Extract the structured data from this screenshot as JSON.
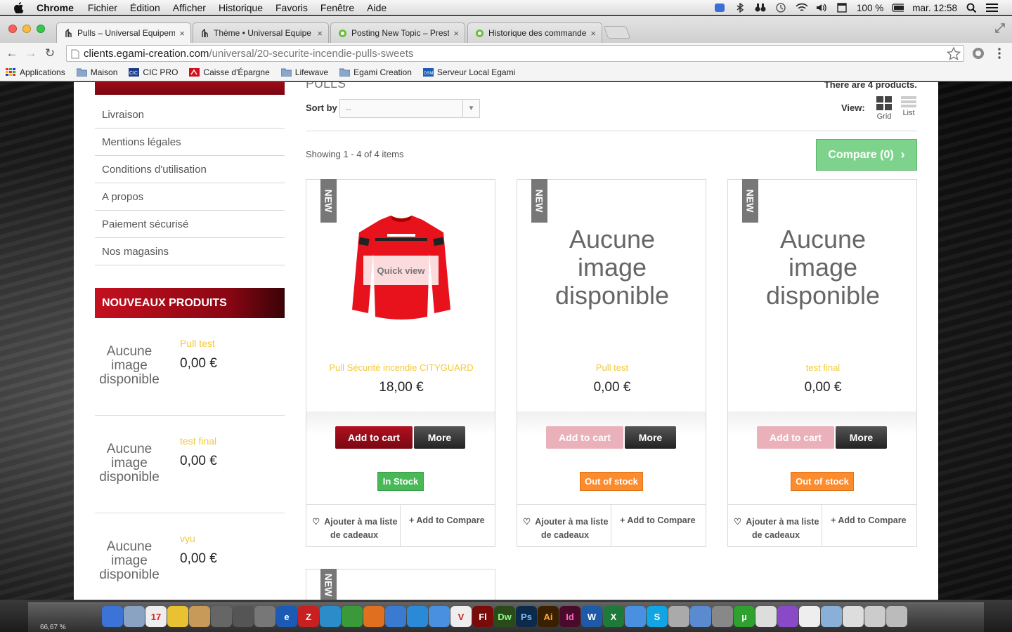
{
  "menubar": {
    "app_name": "Chrome",
    "items": [
      "Fichier",
      "Édition",
      "Afficher",
      "Historique",
      "Favoris",
      "Fenêtre",
      "Aide"
    ],
    "battery": "100 %",
    "clock": "mar. 12:58"
  },
  "tabs": [
    {
      "title": "Pulls – Universal Equipeme",
      "active": true
    },
    {
      "title": "Thème • Universal Equipe",
      "active": false
    },
    {
      "title": "Posting New Topic – Presta",
      "active": false
    },
    {
      "title": "Historique des commande",
      "active": false
    }
  ],
  "omnibox": {
    "host": "clients.egami-creation.com",
    "path": "/universal/20-securite-incendie-pulls-sweets"
  },
  "bookmarks": [
    "Applications",
    "Maison",
    "CIC PRO",
    "Caisse d'Épargne",
    "Lifewave",
    "Egami Creation",
    "Serveur Local Egami"
  ],
  "sidebar": {
    "info_links": [
      "Livraison",
      "Mentions légales",
      "Conditions d'utilisation",
      "A propos",
      "Paiement sécurisé",
      "Nos magasins"
    ],
    "new_products_title": "NOUVEAUX PRODUITS",
    "new_products": [
      {
        "image_text": "Aucune image disponible",
        "name": "Pull test",
        "price": "0,00 €"
      },
      {
        "image_text": "Aucune image disponible",
        "name": "test final",
        "price": "0,00 €"
      },
      {
        "image_text": "Aucune image disponible",
        "name": "vyu",
        "price": "0,00 €"
      }
    ]
  },
  "listing": {
    "title": "PULLS",
    "count_text": "There are 4 products.",
    "sort_label": "Sort by",
    "sort_value": "--",
    "view_label": "View:",
    "view_grid": "Grid",
    "view_list": "List",
    "showing": "Showing 1 - 4 of 4 items",
    "compare": "Compare (0)",
    "new_badge": "NEW",
    "quick_view": "Quick view",
    "add_to_cart": "Add to cart",
    "more": "More",
    "wishlist_line1": "Ajouter à ma liste",
    "wishlist_line2": "de cadeaux",
    "add_to_compare": "Add to Compare",
    "products": [
      {
        "name": "Pull Sécurité incendie CITYGUARD",
        "price": "18,00 €",
        "availability": "In Stock",
        "in_stock": true,
        "has_image": true,
        "image_text": ""
      },
      {
        "name": "Pull test",
        "price": "0,00 €",
        "availability": "Out of stock",
        "in_stock": false,
        "has_image": false,
        "image_text": "Aucune image disponible"
      },
      {
        "name": "test final",
        "price": "0,00 €",
        "availability": "Out of stock",
        "in_stock": false,
        "has_image": false,
        "image_text": "Aucune image disponible"
      }
    ]
  },
  "dock": {
    "zoom": "66,67 %"
  },
  "colors": {
    "accent_red": "#b01020",
    "in_stock_green": "#48b956",
    "out_of_stock_orange": "#fb8b2c",
    "product_name_yellow": "#f1c93a",
    "compare_green": "#7ed38c"
  }
}
